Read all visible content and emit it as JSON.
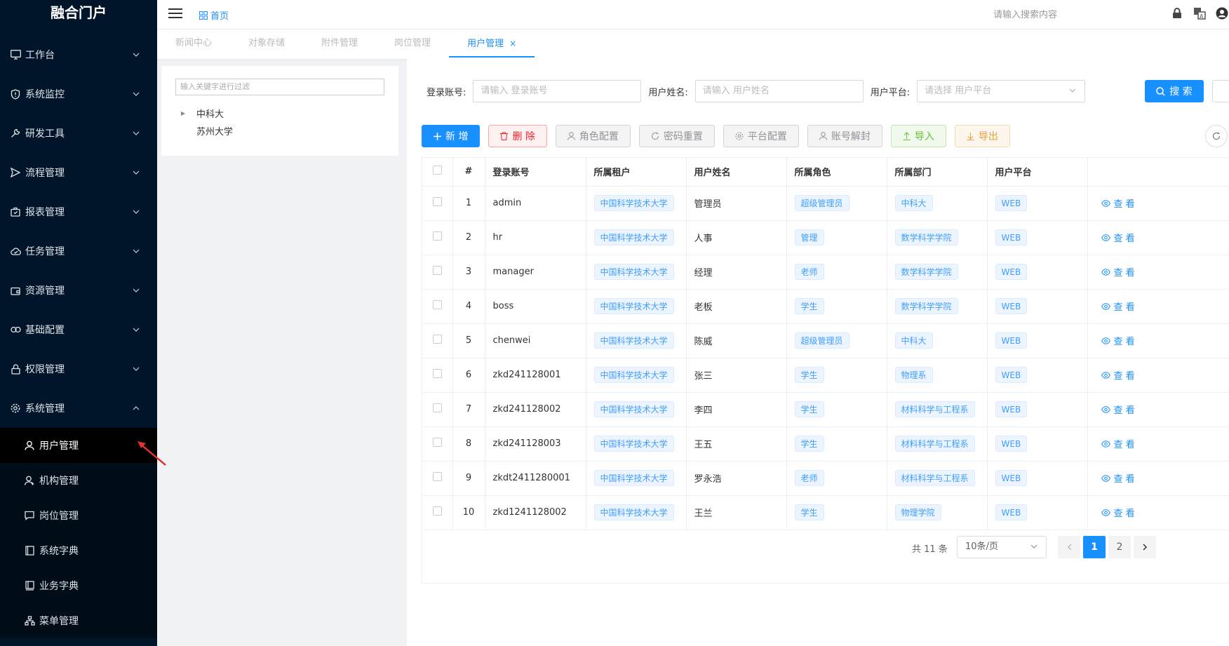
{
  "app": {
    "title": "融合门户"
  },
  "sidebar": {
    "menu": [
      {
        "label": "工作台",
        "icon": "monitor-icon"
      },
      {
        "label": "系统监控",
        "icon": "shield-icon"
      },
      {
        "label": "研发工具",
        "icon": "wrench-icon"
      },
      {
        "label": "流程管理",
        "icon": "send-icon"
      },
      {
        "label": "报表管理",
        "icon": "briefcase-icon"
      },
      {
        "label": "任务管理",
        "icon": "cloud-icon"
      },
      {
        "label": "资源管理",
        "icon": "wallet-icon"
      },
      {
        "label": "基础配置",
        "icon": "link-icon"
      },
      {
        "label": "权限管理",
        "icon": "lock-icon"
      },
      {
        "label": "系统管理",
        "icon": "gear-icon"
      }
    ],
    "submenu": [
      {
        "label": "用户管理",
        "icon": "user-icon",
        "active": true
      },
      {
        "label": "机构管理",
        "icon": "org-user-icon"
      },
      {
        "label": "岗位管理",
        "icon": "chat-icon"
      },
      {
        "label": "系统字典",
        "icon": "book-icon"
      },
      {
        "label": "业务字典",
        "icon": "notebook-icon"
      },
      {
        "label": "菜单管理",
        "icon": "sitemap-icon"
      }
    ]
  },
  "header": {
    "breadcrumb": "首页",
    "search_placeholder": "请输入搜索内容"
  },
  "tabs": [
    {
      "label": "新闻中心"
    },
    {
      "label": "对象存储"
    },
    {
      "label": "附件管理"
    },
    {
      "label": "岗位管理"
    },
    {
      "label": "用户管理",
      "active": true,
      "close": "×"
    }
  ],
  "tree": {
    "filter_placeholder": "输入关键字进行过滤",
    "nodes": [
      "中科大",
      "苏州大学"
    ]
  },
  "filters": {
    "account_label": "登录账号:",
    "account_placeholder": "请输入 登录账号",
    "name_label": "用户姓名:",
    "name_placeholder": "请输入 用户姓名",
    "platform_label": "用户平台:",
    "platform_placeholder": "请选择 用户平台",
    "search_label": "搜 索"
  },
  "actions": {
    "add": "新 增",
    "delete": "删 除",
    "role": "角色配置",
    "reset_pwd": "密码重置",
    "platform": "平台配置",
    "unlock": "账号解封",
    "import": "导入",
    "export": "导出"
  },
  "table": {
    "headers": [
      "#",
      "登录账号",
      "所属租户",
      "用户姓名",
      "所属角色",
      "所属部门",
      "用户平台"
    ],
    "view_label": "查 看",
    "rows": [
      {
        "idx": "1",
        "account": "admin",
        "tenant": "中国科学技术大学",
        "name": "管理员",
        "role": "超级管理员",
        "dept": "中科大",
        "platform": "WEB"
      },
      {
        "idx": "2",
        "account": "hr",
        "tenant": "中国科学技术大学",
        "name": "人事",
        "role": "管理",
        "dept": "数学科学学院",
        "platform": "WEB"
      },
      {
        "idx": "3",
        "account": "manager",
        "tenant": "中国科学技术大学",
        "name": "经理",
        "role": "老师",
        "dept": "数学科学学院",
        "platform": "WEB"
      },
      {
        "idx": "4",
        "account": "boss",
        "tenant": "中国科学技术大学",
        "name": "老板",
        "role": "学生",
        "dept": "数学科学学院",
        "platform": "WEB"
      },
      {
        "idx": "5",
        "account": "chenwei",
        "tenant": "中国科学技术大学",
        "name": "陈威",
        "role": "超级管理员",
        "dept": "中科大",
        "platform": "WEB"
      },
      {
        "idx": "6",
        "account": "zkd241128001",
        "tenant": "中国科学技术大学",
        "name": "张三",
        "role": "学生",
        "dept": "物理系",
        "platform": "WEB"
      },
      {
        "idx": "7",
        "account": "zkd241128002",
        "tenant": "中国科学技术大学",
        "name": "李四",
        "role": "学生",
        "dept": "材料科学与工程系",
        "platform": "WEB"
      },
      {
        "idx": "8",
        "account": "zkd241128003",
        "tenant": "中国科学技术大学",
        "name": "王五",
        "role": "学生",
        "dept": "材料科学与工程系",
        "platform": "WEB"
      },
      {
        "idx": "9",
        "account": "zkdt2411280001",
        "tenant": "中国科学技术大学",
        "name": "罗永浩",
        "role": "老师",
        "dept": "材料科学与工程系",
        "platform": "WEB"
      },
      {
        "idx": "10",
        "account": "zkd1241128002",
        "tenant": "中国科学技术大学",
        "name": "王兰",
        "role": "学生",
        "dept": "物理学院",
        "platform": "WEB"
      }
    ]
  },
  "pagination": {
    "total": "共 11 条",
    "page_size": "10条/页",
    "pages": [
      "1",
      "2"
    ],
    "current": "1"
  },
  "colors": {
    "primary": "#1890ff",
    "sidebar_bg": "#001529",
    "annotation": "#e0332c"
  }
}
